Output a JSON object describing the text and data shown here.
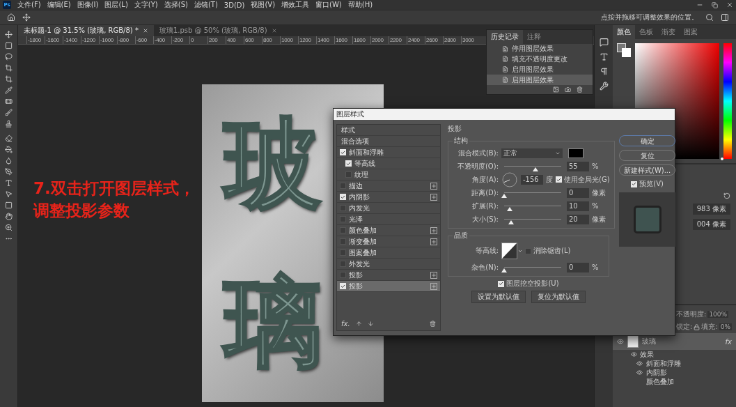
{
  "menu": {
    "app_icon": "Ps",
    "items": [
      "文件(F)",
      "编辑(E)",
      "图像(I)",
      "图层(L)",
      "文字(Y)",
      "选择(S)",
      "滤镜(T)",
      "3D(D)",
      "视图(V)",
      "增效工具",
      "窗口(W)",
      "帮助(H)"
    ]
  },
  "options_bar": {
    "hint": "点按并拖移可调整效果的位置。"
  },
  "document_tabs": [
    {
      "label": "未标题-1 @ 31.5% (玻璃, RGB/8) *",
      "selected": true
    },
    {
      "label": "玻璃1.psb @ 50% (玻璃, RGB/8)",
      "selected": false
    }
  ],
  "ruler": {
    "labels": [
      "-1800",
      "-1600",
      "-1400",
      "-1200",
      "-1000",
      "-800",
      "-600",
      "-400",
      "-200",
      "0",
      "200",
      "400",
      "600",
      "800",
      "1000",
      "1200",
      "1400",
      "1600",
      "1800",
      "2000",
      "2200",
      "2400",
      "2600",
      "2800",
      "3000"
    ]
  },
  "canvas": {
    "glyphs": [
      "玻",
      "璃"
    ]
  },
  "annotation": {
    "lines": [
      "7.双击打开图层样式，",
      "调整投影参数"
    ]
  },
  "history_panel": {
    "tabs": [
      {
        "label": "历史记录",
        "selected": true
      },
      {
        "label": "注释",
        "selected": false
      }
    ],
    "items": [
      {
        "label": "停用图层效果",
        "selected": false
      },
      {
        "label": "填充不透明度更改",
        "selected": false
      },
      {
        "label": "启用图层效果",
        "selected": false
      },
      {
        "label": "启用图层效果",
        "selected": true
      }
    ]
  },
  "color_panel": {
    "hue_slider": {
      "level": 0
    },
    "tabs": [
      {
        "label": "颜色",
        "selected": true
      },
      {
        "label": "色板",
        "selected": false
      },
      {
        "label": "渐变",
        "selected": false
      },
      {
        "label": "图案",
        "selected": false
      }
    ]
  },
  "properties_panel": {
    "fields": [
      "983 像素",
      "004 像素"
    ]
  },
  "layers_panel": {
    "opacity_label": "不透明度:",
    "opacity": "100%",
    "lock_label": "锁定:",
    "fill_label": "填充:",
    "fill": "0%",
    "layers": [
      {
        "name": "玻璃",
        "selected": true,
        "visible": true,
        "fx": "fx",
        "effects_label": "效果",
        "effects": [
          {
            "name": "斜面和浮雕",
            "visible": true
          },
          {
            "name": "内阴影",
            "visible": true
          },
          {
            "name": "颜色叠加",
            "visible": false
          }
        ]
      }
    ]
  },
  "layer_style_dialog": {
    "title": "图层样式",
    "styles": [
      {
        "label": "样式",
        "kind": "header",
        "selected": false
      },
      {
        "label": "混合选项",
        "kind": "header",
        "selected": false
      },
      {
        "label": "斜面和浮雕",
        "kind": "effect",
        "checked": true,
        "addable": false,
        "selected": false,
        "children": [
          {
            "label": "等高线",
            "kind": "effect",
            "checked": true,
            "addable": false,
            "selected": false
          },
          {
            "label": "纹理",
            "kind": "effect",
            "checked": false,
            "addable": false,
            "selected": false
          }
        ]
      },
      {
        "label": "描边",
        "kind": "effect",
        "checked": false,
        "addable": true,
        "selected": false
      },
      {
        "label": "内阴影",
        "kind": "effect",
        "checked": true,
        "addable": true,
        "selected": false
      },
      {
        "label": "内发光",
        "kind": "effect",
        "checked": false,
        "addable": false,
        "selected": false
      },
      {
        "label": "光泽",
        "kind": "effect",
        "checked": false,
        "addable": false,
        "selected": false
      },
      {
        "label": "颜色叠加",
        "kind": "effect",
        "checked": false,
        "addable": true,
        "selected": false
      },
      {
        "label": "渐变叠加",
        "kind": "effect",
        "checked": false,
        "addable": true,
        "selected": false
      },
      {
        "label": "图案叠加",
        "kind": "effect",
        "checked": false,
        "addable": false,
        "selected": false
      },
      {
        "label": "外发光",
        "kind": "effect",
        "checked": false,
        "addable": false,
        "selected": false
      },
      {
        "label": "投影",
        "kind": "effect",
        "checked": false,
        "addable": true,
        "selected": false
      },
      {
        "label": "投影",
        "kind": "effect",
        "checked": true,
        "addable": true,
        "selected": true
      }
    ],
    "footer_fx": "fx.",
    "section_title": "投影",
    "structure": {
      "title": "结构",
      "blend_mode_label": "混合模式(B):",
      "blend_mode": "正常",
      "color": "#000000",
      "opacity": {
        "label": "不透明度(O):",
        "level": 0.55,
        "value": "55",
        "unit": "%"
      },
      "angle": {
        "label": "角度(A):",
        "value": "-156",
        "unit": "度",
        "global_light": {
          "label": "使用全局光(G)",
          "checked": true
        }
      },
      "sliders": [
        {
          "label": "距离(D):",
          "level": 0,
          "value": "0",
          "unit": "像素"
        },
        {
          "label": "扩展(R):",
          "level": 0.1,
          "value": "10",
          "unit": "%"
        },
        {
          "label": "大小(S):",
          "level": 0.12,
          "value": "20",
          "unit": "像素"
        }
      ]
    },
    "quality": {
      "title": "品质",
      "contour_label": "等高线:",
      "anti_alias": {
        "label": "消除锯齿(L)",
        "checked": false
      },
      "noise": {
        "label": "杂色(N):",
        "level": 0,
        "value": "0",
        "unit": "%"
      }
    },
    "knockout": {
      "label": "图层挖空投影(U)",
      "checked": true
    },
    "default_buttons": [
      "设置为默认值",
      "复位为默认值"
    ],
    "buttons": [
      "确定",
      "复位",
      "新建样式(W)..."
    ],
    "preview": {
      "label": "预览(V)",
      "checked": true
    }
  }
}
